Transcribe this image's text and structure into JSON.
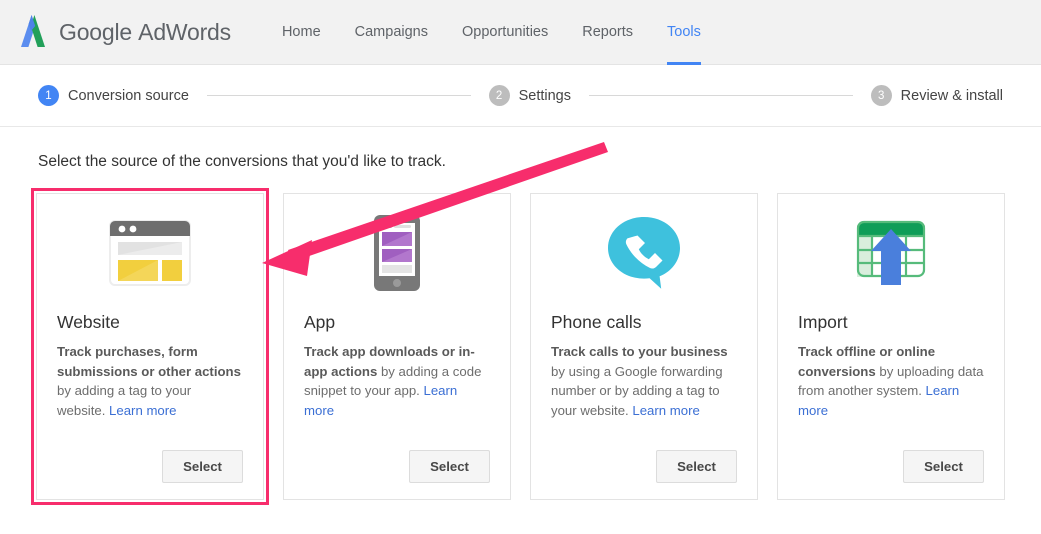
{
  "header": {
    "logo_icon": "adwords-logo-icon",
    "brand_google": "Google",
    "brand_product": "AdWords",
    "nav": [
      {
        "label": "Home",
        "active": false
      },
      {
        "label": "Campaigns",
        "active": false
      },
      {
        "label": "Opportunities",
        "active": false
      },
      {
        "label": "Reports",
        "active": false
      },
      {
        "label": "Tools",
        "active": true
      }
    ]
  },
  "stepper": {
    "steps": [
      {
        "number": "1",
        "label": "Conversion source",
        "active": true
      },
      {
        "number": "2",
        "label": "Settings",
        "active": false
      },
      {
        "number": "3",
        "label": "Review & install",
        "active": false
      }
    ]
  },
  "main": {
    "heading": "Select the source of the conversions that you'd like to track.",
    "cards": [
      {
        "icon": "website-browser-icon",
        "title": "Website",
        "desc_bold": "Track purchases, form submissions or other actions",
        "desc_rest": " by adding a tag to your website. ",
        "link": "Learn more",
        "button": "Select",
        "selected": true
      },
      {
        "icon": "mobile-app-icon",
        "title": "App",
        "desc_bold": "Track app downloads or in-app actions",
        "desc_rest": " by adding a code snippet to your app. ",
        "link": "Learn more",
        "button": "Select",
        "selected": false
      },
      {
        "icon": "phone-call-bubble-icon",
        "title": "Phone calls",
        "desc_bold": "Track calls to your business",
        "desc_rest": " by using a Google forwarding number or by adding a tag to your website. ",
        "link": "Learn more",
        "button": "Select",
        "selected": false
      },
      {
        "icon": "spreadsheet-upload-icon",
        "title": "Import",
        "desc_bold": "Track offline or online conversions",
        "desc_rest": " by uploading data from another system. ",
        "link": "Learn more",
        "button": "Select",
        "selected": false
      }
    ]
  },
  "annotation": {
    "arrow_color": "#f72d6c",
    "points_to": "Website"
  },
  "colors": {
    "accent_blue": "#4285f4",
    "header_bg": "#f2f2f2",
    "highlight_pink": "#f72d6c",
    "link_blue": "#3b6fd4"
  }
}
